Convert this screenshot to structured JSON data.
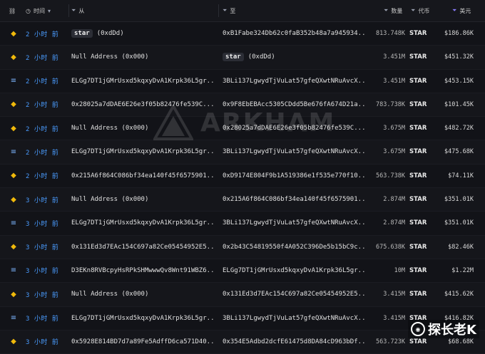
{
  "header": {
    "time_label": "时间",
    "from_label": "从",
    "to_label": "至",
    "amount_label": "数量",
    "token_label": "代币",
    "usd_label": "美元"
  },
  "watermark": "ARKHAM",
  "brand": "探长老K",
  "rows": [
    {
      "chain": "bnb",
      "time": "2 小时 前",
      "from_tag": "star",
      "from": "(0xdDd)",
      "to_tag": "",
      "to": "0xB1Fabe324Db62c0faB352b48a7a945934...",
      "amount": "813.748K",
      "token": "STAR",
      "usd": "$186.86K"
    },
    {
      "chain": "bnb",
      "time": "2 小时 前",
      "from_tag": "",
      "from": "Null Address (0x000)",
      "to_tag": "star",
      "to": "(0xdDd)",
      "amount": "3.451M",
      "token": "STAR",
      "usd": "$451.32K"
    },
    {
      "chain": "tron",
      "time": "2 小时 前",
      "from_tag": "",
      "from": "ELGg7DT1jGMrUsxd5kqxyDvA1Krpk36L5gr...",
      "to_tag": "",
      "to": "3BLi137LgwydTjVuLat57gfeQXwtNRuAvcX...",
      "amount": "3.451M",
      "token": "STAR",
      "usd": "$453.15K"
    },
    {
      "chain": "bnb",
      "time": "2 小时 前",
      "from_tag": "",
      "from": "0x28025a7dDAE6E26e3f05b82476fe539C...",
      "to_tag": "",
      "to": "0x9F8EbEBAcc5305CDdd5Be676fA674D21a...",
      "amount": "783.738K",
      "token": "STAR",
      "usd": "$101.45K"
    },
    {
      "chain": "bnb",
      "time": "2 小时 前",
      "from_tag": "",
      "from": "Null Address (0x000)",
      "to_tag": "",
      "to": "0x28025a7dDAE6E26e3f05b82476fe539C...",
      "amount": "3.675M",
      "token": "STAR",
      "usd": "$482.72K"
    },
    {
      "chain": "tron",
      "time": "2 小时 前",
      "from_tag": "",
      "from": "ELGg7DT1jGMrUsxd5kqxyDvA1Krpk36L5gr...",
      "to_tag": "",
      "to": "3BLi137LgwydTjVuLat57gfeQXwtNRuAvcX...",
      "amount": "3.675M",
      "token": "STAR",
      "usd": "$475.68K"
    },
    {
      "chain": "bnb",
      "time": "2 小时 前",
      "from_tag": "",
      "from": "0x215A6f864C086bf34ea140f45f6575901...",
      "to_tag": "",
      "to": "0xD9174E804F9b1A519386e1f535e770f10...",
      "amount": "563.738K",
      "token": "STAR",
      "usd": "$74.11K"
    },
    {
      "chain": "bnb",
      "time": "3 小时 前",
      "from_tag": "",
      "from": "Null Address (0x000)",
      "to_tag": "",
      "to": "0x215A6f864C086bf34ea140f45f6575901...",
      "amount": "2.874M",
      "token": "STAR",
      "usd": "$351.01K"
    },
    {
      "chain": "tron",
      "time": "3 小时 前",
      "from_tag": "",
      "from": "ELGg7DT1jGMrUsxd5kqxyDvA1Krpk36L5gr...",
      "to_tag": "",
      "to": "3BLi137LgwydTjVuLat57gfeQXwtNRuAvcX...",
      "amount": "2.874M",
      "token": "STAR",
      "usd": "$351.01K"
    },
    {
      "chain": "bnb",
      "time": "3 小时 前",
      "from_tag": "",
      "from": "0x131Ed3d7EAc154C697a82Ce05454952E5...",
      "to_tag": "",
      "to": "0x2b43C54819550f4A052C396De5b15bC9c...",
      "amount": "675.638K",
      "token": "STAR",
      "usd": "$82.46K"
    },
    {
      "chain": "tron",
      "time": "3 小时 前",
      "from_tag": "",
      "from": "D3EKn8RVBcpyHsRPkSHMwwwQv8Wnt91WBZ6...",
      "to_tag": "",
      "to": "ELGg7DT1jGMrUsxd5kqxyDvA1Krpk36L5gr...",
      "amount": "10M",
      "token": "STAR",
      "usd": "$1.22M"
    },
    {
      "chain": "bnb",
      "time": "3 小时 前",
      "from_tag": "",
      "from": "Null Address (0x000)",
      "to_tag": "",
      "to": "0x131Ed3d7EAc154C697a82Ce05454952E5...",
      "amount": "3.415M",
      "token": "STAR",
      "usd": "$415.62K"
    },
    {
      "chain": "tron",
      "time": "3 小时 前",
      "from_tag": "",
      "from": "ELGg7DT1jGMrUsxd5kqxyDvA1Krpk36L5gr...",
      "to_tag": "",
      "to": "3BLi137LgwydTjVuLat57gfeQXwtNRuAvcX...",
      "amount": "3.415M",
      "token": "STAR",
      "usd": "$416.82K"
    },
    {
      "chain": "bnb",
      "time": "3 小时 前",
      "from_tag": "",
      "from": "0x5928E814BD7d7a89Fe5AdffD6ca571D40...",
      "to_tag": "",
      "to": "0x354E5Adbd2dcfE61475d8DA84cD963bDf...",
      "amount": "563.723K",
      "token": "STAR",
      "usd": "$68.68K"
    }
  ]
}
